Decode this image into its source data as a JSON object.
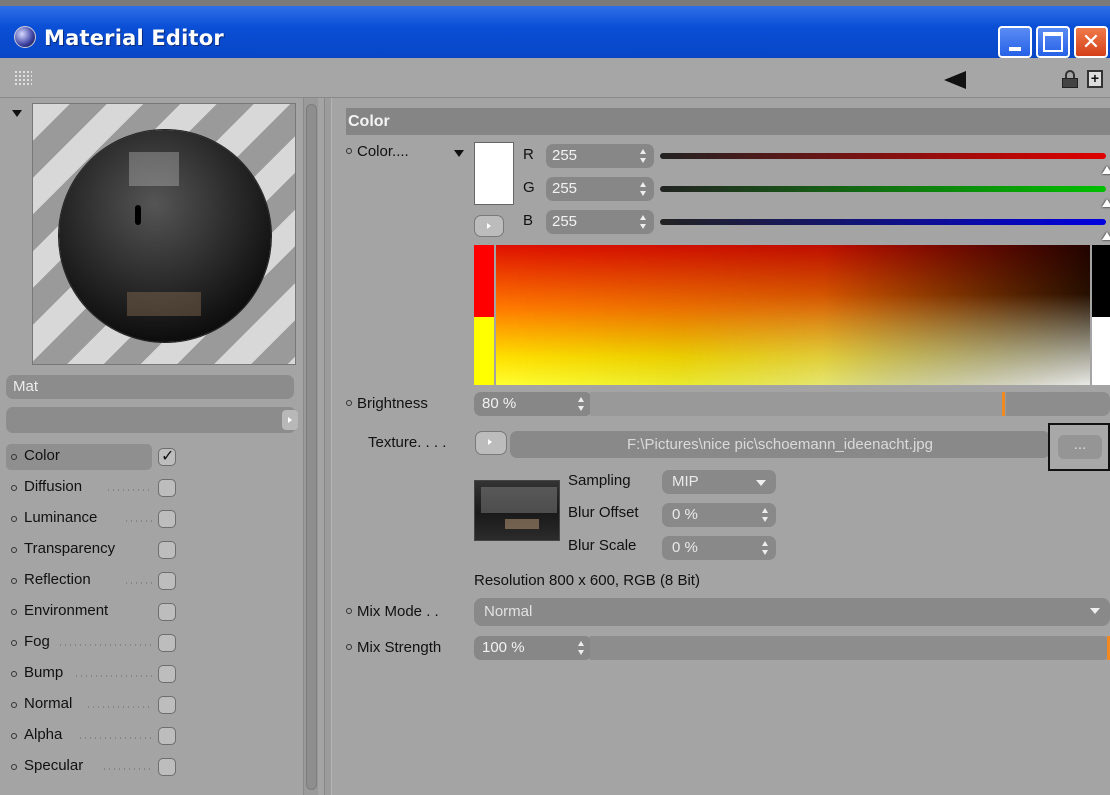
{
  "window": {
    "title": "Material Editor"
  },
  "material": {
    "name": "Mat"
  },
  "channels": [
    {
      "label": "Color",
      "checked": true
    },
    {
      "label": "Diffusion",
      "checked": false
    },
    {
      "label": "Luminance",
      "checked": false
    },
    {
      "label": "Transparency",
      "checked": false
    },
    {
      "label": "Reflection",
      "checked": false
    },
    {
      "label": "Environment",
      "checked": false
    },
    {
      "label": "Fog",
      "checked": false
    },
    {
      "label": "Bump",
      "checked": false
    },
    {
      "label": "Normal",
      "checked": false
    },
    {
      "label": "Alpha",
      "checked": false
    },
    {
      "label": "Specular",
      "checked": false
    }
  ],
  "color_section": {
    "header": "Color",
    "color_label": "Color",
    "r_label": "R",
    "r_value": "255",
    "g_label": "G",
    "g_value": "255",
    "b_label": "B",
    "b_value": "255",
    "brightness_label": "Brightness",
    "brightness_value": "80 %",
    "brightness_level": 0.8,
    "texture_label": "Texture",
    "texture_path": "F:\\Pictures\\nice pic\\schoemann_ideenacht.jpg",
    "texture_browse": "...",
    "sampling_label": "Sampling",
    "sampling_value": "MIP",
    "blur_offset_label": "Blur Offset",
    "blur_offset_value": "0 %",
    "blur_scale_label": "Blur Scale",
    "blur_scale_value": "0 %",
    "resolution_text": "Resolution 800 x 600, RGB (8 Bit)",
    "mix_mode_label": "Mix Mode",
    "mix_mode_value": "Normal",
    "mix_strength_label": "Mix Strength",
    "mix_strength_value": "100 %",
    "mix_strength_level": 1.0
  },
  "colors": {
    "titlebar": "#0a4fd6",
    "accent_orange": "#f08a20",
    "red_slider": "#e00000",
    "green_slider": "#00c000",
    "blue_slider": "#0000e0"
  }
}
